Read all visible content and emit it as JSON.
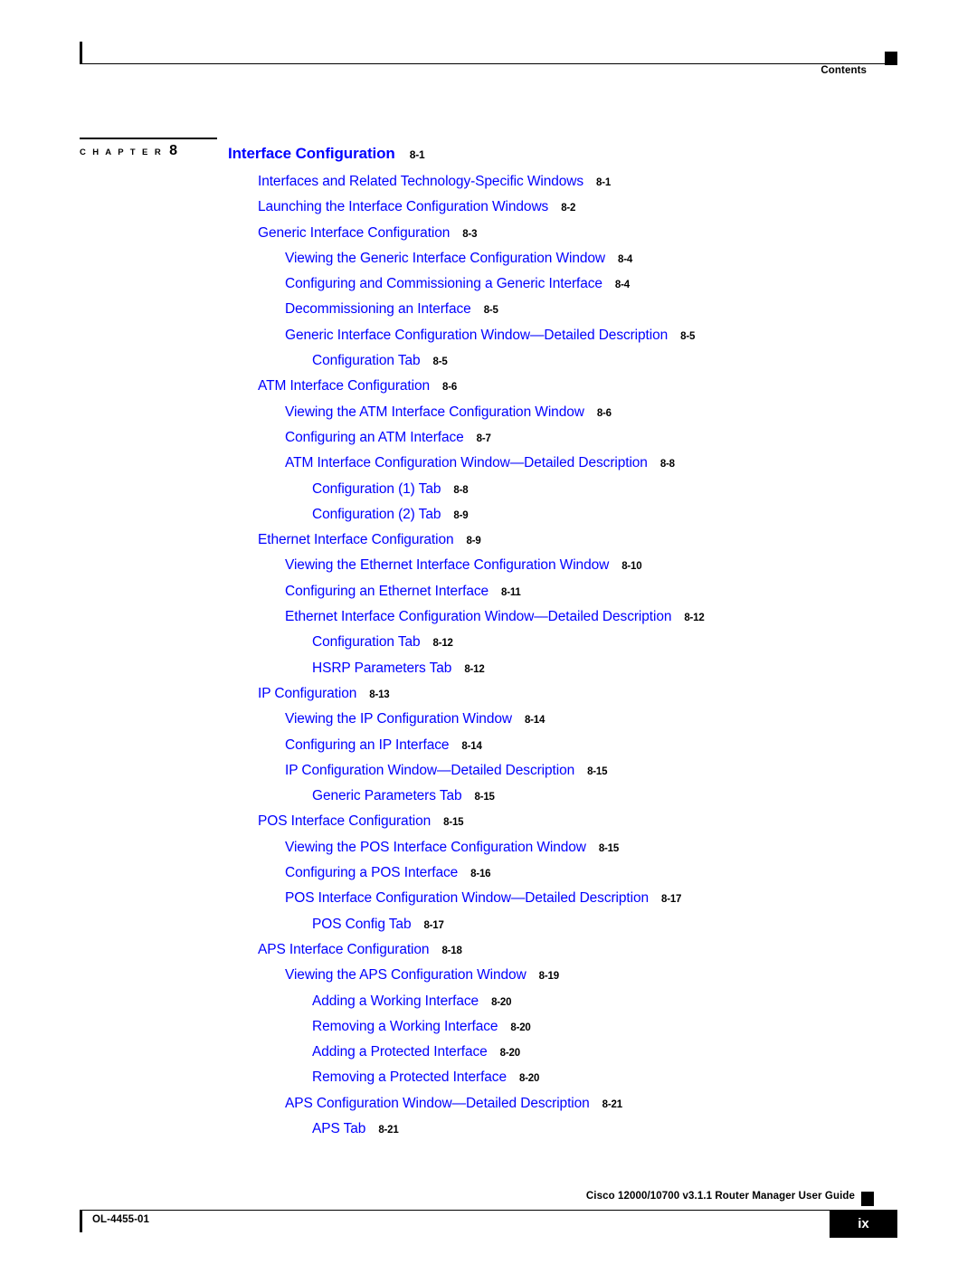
{
  "running_head": {
    "label": "Contents",
    "marker_icon": "black-square-marker"
  },
  "chapter_marker": {
    "word": "C H A P T E R",
    "number": "8"
  },
  "toc": {
    "entries": [
      {
        "level": 0,
        "title": "Interface Configuration",
        "page": "8-1"
      },
      {
        "level": 1,
        "title": "Interfaces and Related Technology-Specific Windows",
        "page": "8-1"
      },
      {
        "level": 1,
        "title": "Launching the Interface Configuration Windows",
        "page": "8-2"
      },
      {
        "level": 1,
        "title": "Generic Interface Configuration",
        "page": "8-3"
      },
      {
        "level": 2,
        "title": "Viewing the Generic Interface Configuration Window",
        "page": "8-4"
      },
      {
        "level": 2,
        "title": "Configuring and Commissioning a Generic Interface",
        "page": "8-4"
      },
      {
        "level": 2,
        "title": "Decommissioning an Interface",
        "page": "8-5"
      },
      {
        "level": 2,
        "title": "Generic Interface Configuration Window—Detailed Description",
        "page": "8-5"
      },
      {
        "level": 3,
        "title": "Configuration Tab",
        "page": "8-5"
      },
      {
        "level": 1,
        "title": "ATM Interface Configuration",
        "page": "8-6"
      },
      {
        "level": 2,
        "title": "Viewing the ATM Interface Configuration Window",
        "page": "8-6"
      },
      {
        "level": 2,
        "title": "Configuring an ATM Interface",
        "page": "8-7"
      },
      {
        "level": 2,
        "title": "ATM Interface Configuration Window—Detailed Description",
        "page": "8-8"
      },
      {
        "level": 3,
        "title": "Configuration (1) Tab",
        "page": "8-8"
      },
      {
        "level": 3,
        "title": "Configuration (2) Tab",
        "page": "8-9"
      },
      {
        "level": 1,
        "title": "Ethernet Interface Configuration",
        "page": "8-9"
      },
      {
        "level": 2,
        "title": "Viewing the Ethernet Interface Configuration Window",
        "page": "8-10"
      },
      {
        "level": 2,
        "title": "Configuring an Ethernet Interface",
        "page": "8-11"
      },
      {
        "level": 2,
        "title": "Ethernet Interface Configuration Window—Detailed Description",
        "page": "8-12"
      },
      {
        "level": 3,
        "title": "Configuration Tab",
        "page": "8-12"
      },
      {
        "level": 3,
        "title": "HSRP Parameters Tab",
        "page": "8-12"
      },
      {
        "level": 1,
        "title": "IP Configuration",
        "page": "8-13"
      },
      {
        "level": 2,
        "title": "Viewing the IP Configuration Window",
        "page": "8-14"
      },
      {
        "level": 2,
        "title": "Configuring an IP Interface",
        "page": "8-14"
      },
      {
        "level": 2,
        "title": "IP Configuration Window—Detailed Description",
        "page": "8-15"
      },
      {
        "level": 3,
        "title": "Generic Parameters Tab",
        "page": "8-15"
      },
      {
        "level": 1,
        "title": "POS Interface Configuration",
        "page": "8-15"
      },
      {
        "level": 2,
        "title": "Viewing the POS Interface Configuration Window",
        "page": "8-15"
      },
      {
        "level": 2,
        "title": "Configuring a POS Interface",
        "page": "8-16"
      },
      {
        "level": 2,
        "title": "POS Interface Configuration Window—Detailed Description",
        "page": "8-17"
      },
      {
        "level": 3,
        "title": "POS Config Tab",
        "page": "8-17"
      },
      {
        "level": 1,
        "title": "APS Interface Configuration",
        "page": "8-18"
      },
      {
        "level": 2,
        "title": "Viewing the APS Configuration Window",
        "page": "8-19"
      },
      {
        "level": 3,
        "title": "Adding a Working Interface",
        "page": "8-20"
      },
      {
        "level": 3,
        "title": "Removing a Working Interface",
        "page": "8-20"
      },
      {
        "level": 3,
        "title": "Adding a Protected Interface",
        "page": "8-20"
      },
      {
        "level": 3,
        "title": "Removing a Protected Interface",
        "page": "8-20"
      },
      {
        "level": 2,
        "title": "APS Configuration Window—Detailed Description",
        "page": "8-21"
      },
      {
        "level": 3,
        "title": "APS Tab",
        "page": "8-21"
      }
    ]
  },
  "footer": {
    "guide_title": "Cisco 12000/10700 v3.1.1 Router Manager User Guide",
    "doc_id": "OL-4455-01",
    "page_number": "ix",
    "marker_icon": "black-square-marker"
  },
  "colors": {
    "link_blue": "#0000ff",
    "text_black": "#000000",
    "page_white": "#ffffff"
  }
}
